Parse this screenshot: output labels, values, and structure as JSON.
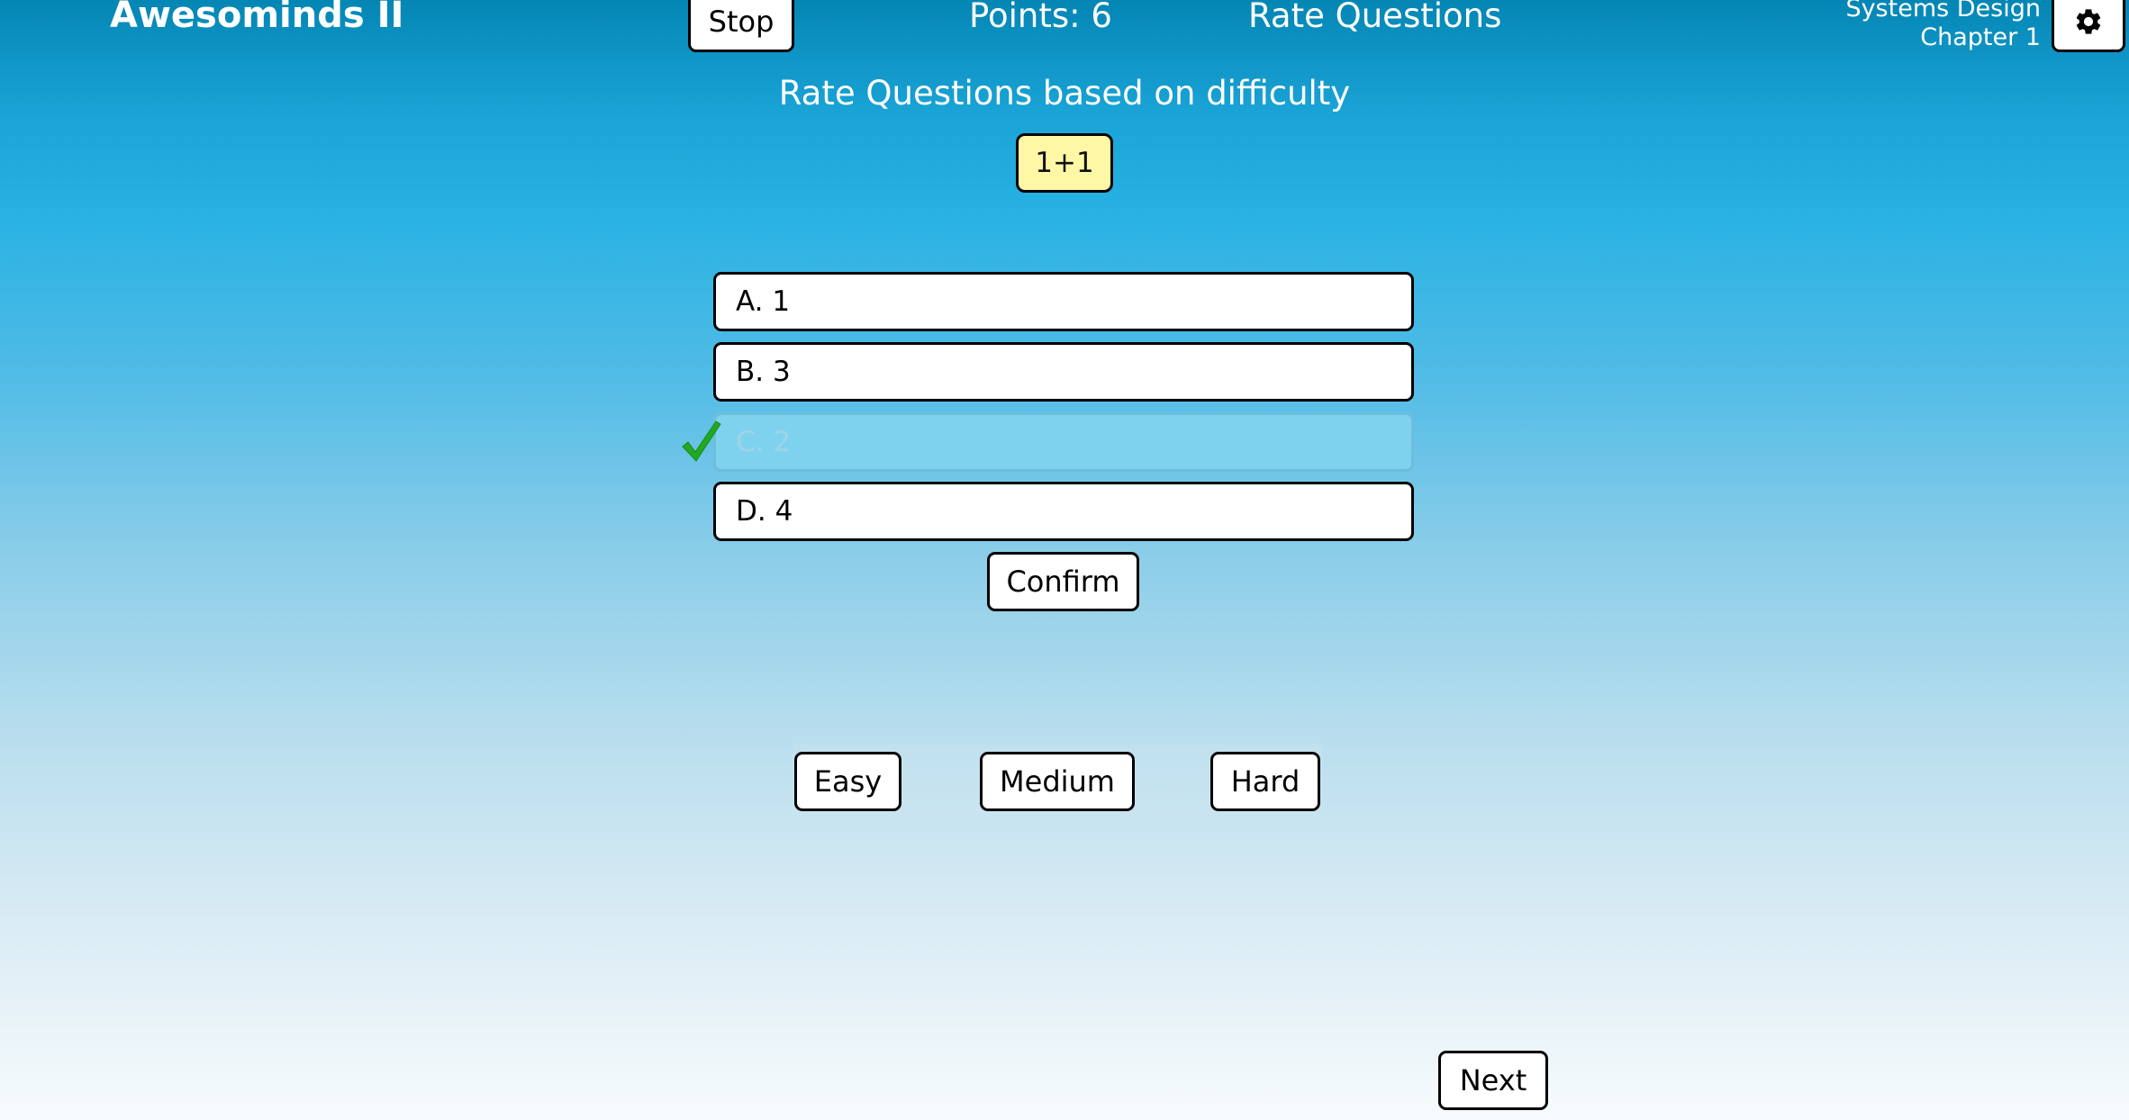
{
  "header": {
    "app_title": "Awesominds II",
    "stop_label": "Stop",
    "points_text": "Points: 6",
    "mode_title": "Rate Questions",
    "course_line1": "Systems Design",
    "course_line2": "Chapter 1",
    "settings_icon": "gear-icon"
  },
  "main": {
    "instruction": "Rate Questions based on difficulty",
    "question": "1+1",
    "answers": [
      {
        "label": "A. 1",
        "selected": false
      },
      {
        "label": "B. 3",
        "selected": false
      },
      {
        "label": "C. 2",
        "selected": true,
        "correct_icon": "checkmark-icon"
      },
      {
        "label": "D. 4",
        "selected": false
      }
    ],
    "confirm_label": "Confirm"
  },
  "rating": {
    "easy_label": "Easy",
    "medium_label": "Medium",
    "hard_label": "Hard"
  },
  "footer": {
    "next_label": "Next"
  },
  "colors": {
    "background_top": "#0486b4",
    "background_bottom": "#f7fbfd",
    "question_chip": "#fdf7a6",
    "selected_answer": "#7fd2ee",
    "checkmark": "#22a822"
  }
}
